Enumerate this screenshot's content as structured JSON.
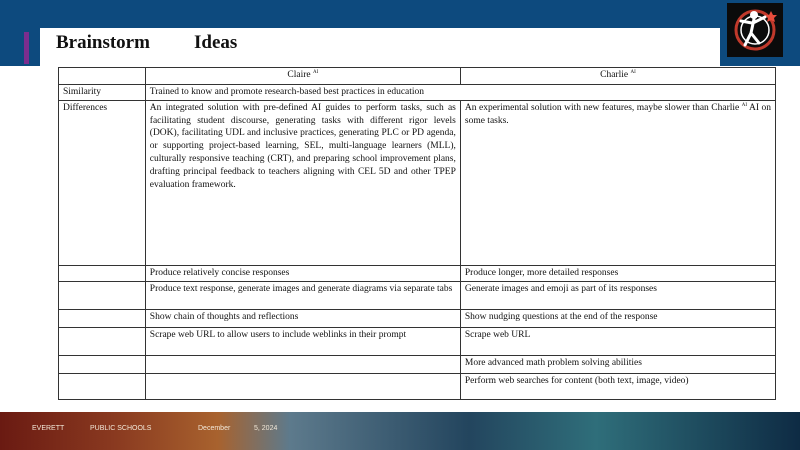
{
  "header": {
    "title_left": "Brainstorm",
    "title_right": "Ideas",
    "logo_icon": "school-logo-icon"
  },
  "table": {
    "columns": [
      "",
      "Claire",
      "Charlie"
    ],
    "superscript": "AI",
    "rows": [
      {
        "label": "Similarity",
        "claire": "Trained to know and promote research-based best practices in education",
        "charlie": ""
      },
      {
        "label": "Differences",
        "claire": "An integrated solution with pre-defined AI guides to perform tasks, such as facilitating student discourse, generating tasks with different rigor levels (DOK), facilitating UDL and inclusive practices, generating PLC or PD agenda, or supporting project-based learning, SEL, multi-language learners (MLL), culturally responsive teaching (CRT), and preparing school improvement plans, drafting principal feedback to teachers aligning with CEL 5D and other TPEP evaluation framework.",
        "charlie": "An experimental solution with new features, maybe slower than Charlie AI on some tasks."
      },
      {
        "label": "",
        "claire": "Produce relatively concise responses",
        "charlie": "Produce longer, more detailed responses"
      },
      {
        "label": "",
        "claire": "Produce text response, generate images and generate diagrams via separate tabs",
        "charlie": "Generate images and emoji as part of its responses"
      },
      {
        "label": "",
        "claire": "Show chain of thoughts and reflections",
        "charlie": "Show nudging questions at the end of the response"
      },
      {
        "label": "",
        "claire": "Scrape web URL to allow users to include weblinks in their prompt",
        "charlie": "Scrape web URL"
      },
      {
        "label": "",
        "claire": "",
        "charlie": "More advanced math problem solving abilities"
      },
      {
        "label": "",
        "claire": "",
        "charlie": "Perform web searches for content (both text, image, video)"
      }
    ]
  },
  "footer": {
    "district": "EVERETT",
    "school": "PUBLIC SCHOOLS",
    "month": "December",
    "date": "5, 2024"
  }
}
